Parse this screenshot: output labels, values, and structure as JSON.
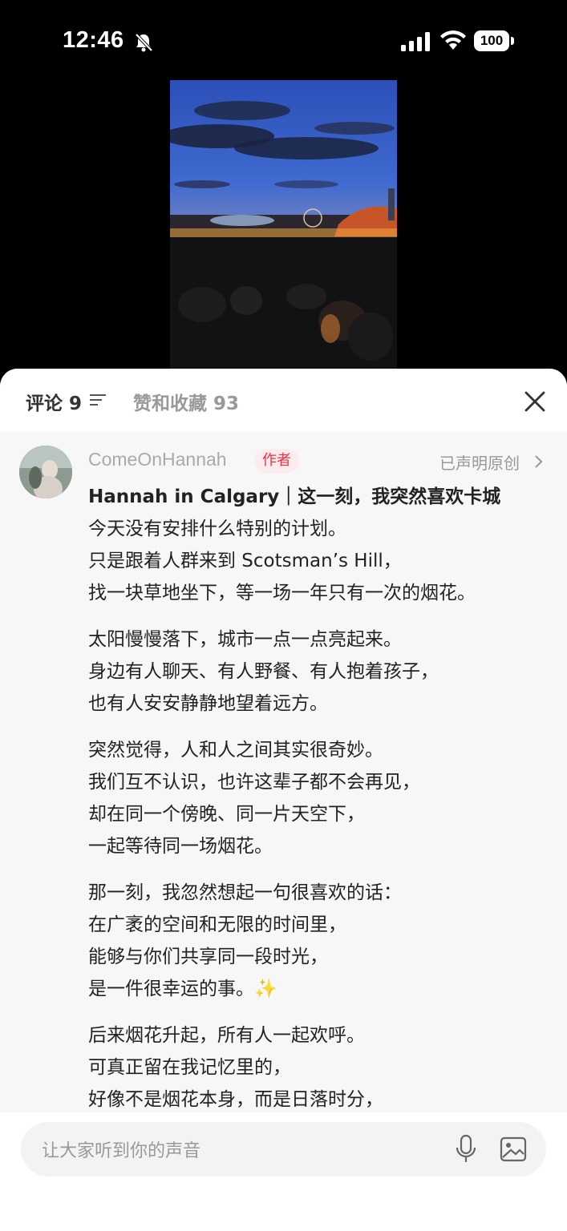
{
  "status_bar": {
    "time": "12:46",
    "battery": "100"
  },
  "sheet": {
    "comments_tab": "评论 9",
    "likes_tab": "赞和收藏 93"
  },
  "post": {
    "author": "ComeOnHannah",
    "author_tag": "作者",
    "original_label": "已声明原创",
    "paragraphs": [
      [
        "Hannah in Calgary｜这一刻，我突然喜欢卡城",
        "今天没有安排什么特别的计划。",
        "只是跟着人群来到 Scotsman’s Hill，",
        "找一块草地坐下，等一场一年只有一次的烟花。"
      ],
      [
        "太阳慢慢落下，城市一点一点亮起来。",
        "身边有人聊天、有人野餐、有人抱着孩子，",
        "也有人安安静静地望着远方。"
      ],
      [
        "突然觉得，人和人之间其实很奇妙。",
        "我们互不认识，也许这辈子都不会再见，",
        "却在同一个傍晚、同一片天空下，",
        "一起等待同一场烟花。"
      ],
      [
        "那一刻，我忽然想起一句很喜欢的话：",
        "在广袤的空间和无限的时间里，",
        "能够与你们共享同一段时光，",
        "是一件很幸运的事。"
      ],
      [
        "后来烟花升起，所有人一起欢呼。",
        "可真正留在我记忆里的，",
        "好像不是烟花本身，而是日落时分，"
      ]
    ],
    "sparkle_emoji": "✨"
  },
  "input": {
    "placeholder": "让大家听到你的声音"
  }
}
